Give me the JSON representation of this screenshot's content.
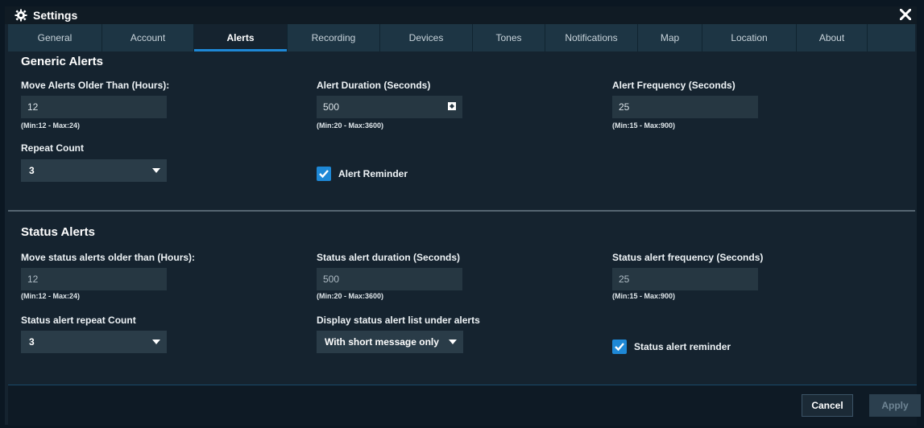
{
  "window": {
    "title": "Settings",
    "close_icon": "close-icon"
  },
  "tabs": [
    {
      "label": "General"
    },
    {
      "label": "Account"
    },
    {
      "label": "Alerts"
    },
    {
      "label": "Recording"
    },
    {
      "label": "Devices"
    },
    {
      "label": "Tones"
    },
    {
      "label": "Notifications"
    },
    {
      "label": "Map"
    },
    {
      "label": "Location"
    },
    {
      "label": "About"
    }
  ],
  "active_tab": "Alerts",
  "generic": {
    "title": "Generic Alerts",
    "move_label": "Move Alerts Older Than (Hours):",
    "move_value": "12",
    "move_hint": "(Min:12 - Max:24)",
    "duration_label": "Alert Duration (Seconds)",
    "duration_value": "500",
    "duration_hint": "(Min:20 - Max:3600)",
    "frequency_label": "Alert Frequency (Seconds)",
    "frequency_value": "25",
    "frequency_hint": "(Min:15 - Max:900)",
    "repeat_label": "Repeat Count",
    "repeat_value": "3",
    "reminder_label": "Alert Reminder",
    "reminder_checked": true
  },
  "status": {
    "title": "Status Alerts",
    "move_label": "Move status alerts older than (Hours):",
    "move_value": "12",
    "move_hint": "(Min:12 - Max:24)",
    "duration_label": "Status alert duration (Seconds)",
    "duration_value": "500",
    "duration_hint": "(Min:20 - Max:3600)",
    "frequency_label": "Status alert frequency (Seconds)",
    "frequency_value": "25",
    "frequency_hint": "(Min:15 - Max:900)",
    "repeat_label": "Status alert repeat Count",
    "repeat_value": "3",
    "display_label": "Display status alert list under alerts",
    "display_value": "With short message only",
    "reminder_label": "Status alert reminder",
    "reminder_checked": true
  },
  "footer": {
    "cancel_label": "Cancel",
    "apply_label": "Apply"
  },
  "colors": {
    "accent": "#1e88d6",
    "background": "#15232f",
    "tabbar": "#1d3544"
  }
}
